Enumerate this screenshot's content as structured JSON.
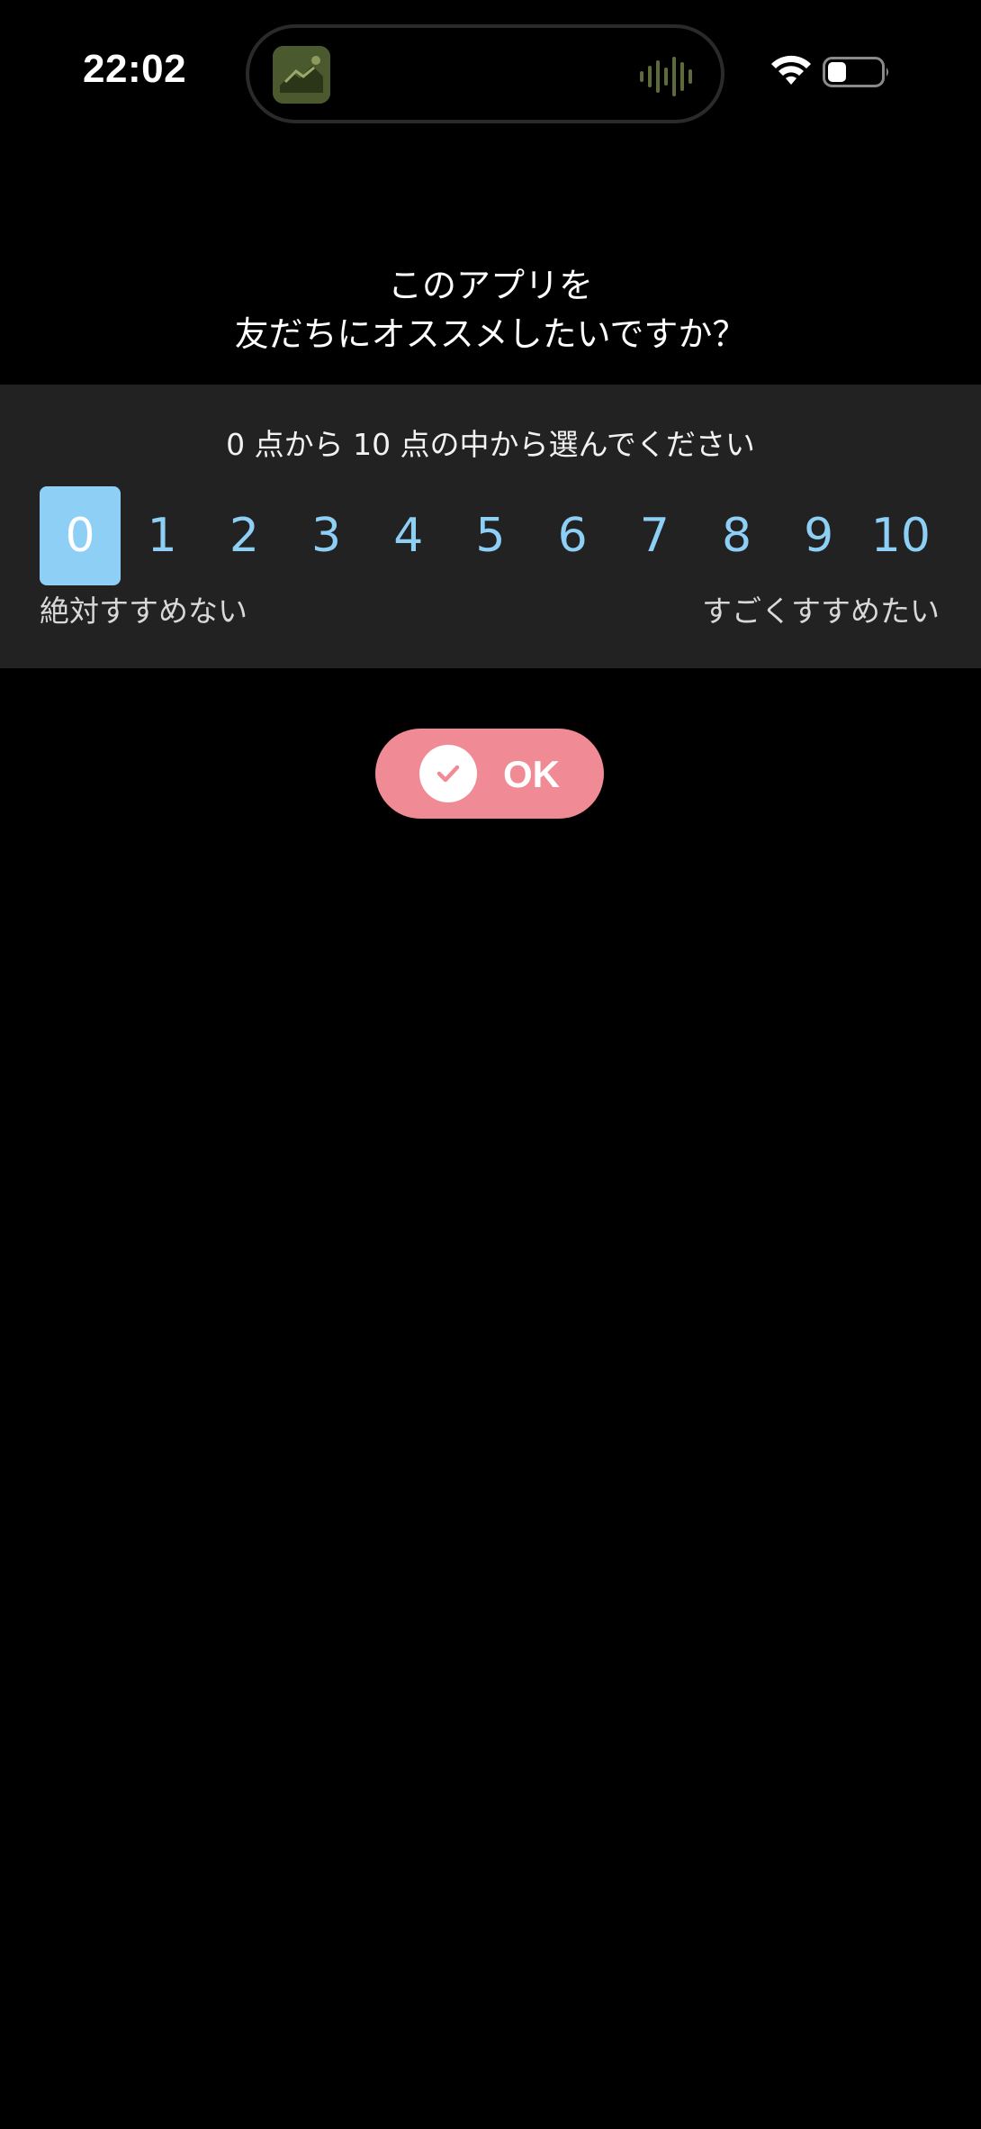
{
  "status_bar": {
    "time": "22:02"
  },
  "question": {
    "line1": "このアプリを",
    "line2": "友だちにオススメしたいですか？"
  },
  "rating": {
    "instruction": "0 点から 10 点の中から選んでください",
    "scores": [
      "0",
      "1",
      "2",
      "3",
      "4",
      "5",
      "6",
      "7",
      "8",
      "9",
      "10"
    ],
    "selected": "0",
    "label_low": "絶対すすめない",
    "label_high": "すごくすすめたい"
  },
  "ok_button": {
    "label": "OK"
  },
  "colors": {
    "accent_blue": "#8ecff6",
    "button_pink": "#f08a95",
    "panel": "#222222",
    "background": "#000000"
  },
  "icons": {
    "wifi": "wifi-icon",
    "battery": "battery-icon",
    "check": "check-icon",
    "audio_wave": "audio-waveform-icon"
  }
}
